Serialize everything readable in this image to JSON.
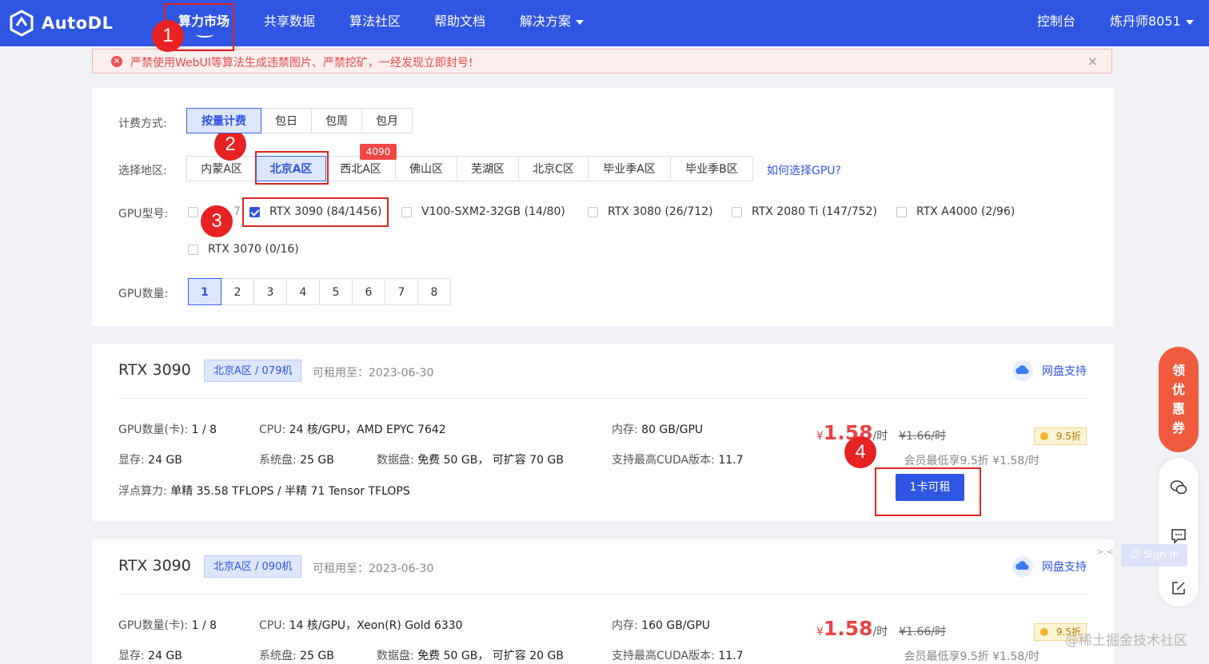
{
  "nav": {
    "brand": "AutoDL",
    "items": [
      "算力市场",
      "共享数据",
      "算法社区",
      "帮助文档",
      "解决方案"
    ],
    "console": "控制台",
    "user": "炼丹师8051"
  },
  "alert": {
    "text": "严禁使用WebUI等算法生成违禁图片、严禁挖矿，一经发现立即封号!",
    "close": "×"
  },
  "filters": {
    "billing_label": "计费方式:",
    "billing_options": [
      "按量计费",
      "包日",
      "包周",
      "包月"
    ],
    "region_label": "选择地区:",
    "region_options": [
      "内蒙A区",
      "北京A区",
      "西北A区",
      "佛山区",
      "芜湖区",
      "北京C区",
      "毕业季A区",
      "毕业季B区"
    ],
    "region_badge": "4090",
    "help_link": "如何选择GPU?",
    "gpu_label": "GPU型号:",
    "gpu_options": [
      {
        "label": "7",
        "checked": false
      },
      {
        "label": "RTX 3090 (84/1456)",
        "checked": true
      },
      {
        "label": "V100-SXM2-32GB (14/80)",
        "checked": false
      },
      {
        "label": "RTX 3080 (26/712)",
        "checked": false
      },
      {
        "label": "RTX 2080 Ti (147/752)",
        "checked": false
      },
      {
        "label": "RTX A4000 (2/96)",
        "checked": false
      },
      {
        "label": "RTX 3070 (0/16)",
        "checked": false
      }
    ],
    "count_label": "GPU数量:",
    "count_options": [
      "1",
      "2",
      "3",
      "4",
      "5",
      "6",
      "7",
      "8"
    ]
  },
  "cards": [
    {
      "title": "RTX 3090",
      "region": "北京A区 / 079机",
      "rent_until": "可租用至：2023-06-30",
      "cloud": "网盘支持",
      "gpu_count_label": "GPU数量(卡):",
      "gpu_count": "1 / 8",
      "cpu_label": "CPU:",
      "cpu": "24 核/GPU，AMD EPYC 7642",
      "mem_label": "内存:",
      "mem": "80 GB/GPU",
      "vram_label": "显存:",
      "vram": "24 GB",
      "sys_disk_label": "系统盘:",
      "sys_disk": "25 GB",
      "data_disk_label": "数据盘:",
      "data_disk": "免费 50 GB， 可扩容 70 GB",
      "cuda_label": "支持最高CUDA版本:",
      "cuda": "11.7",
      "flops_label": "浮点算力:",
      "flops": "单精 35.58 TFLOPS / 半精 71 Tensor TFLOPS",
      "currency": "¥",
      "price": "1.58",
      "unit": "/时",
      "orig_price": "¥1.66/时",
      "discount": "9.5折",
      "member": "会员最低享9.5折 ¥1.58/时",
      "rent_button": "1卡可租"
    },
    {
      "title": "RTX 3090",
      "region": "北京A区 / 090机",
      "rent_until": "可租用至：2023-06-30",
      "cloud": "网盘支持",
      "gpu_count_label": "GPU数量(卡):",
      "gpu_count": "1 / 8",
      "cpu_label": "CPU:",
      "cpu": "14 核/GPU，Xeon(R) Gold 6330",
      "mem_label": "内存:",
      "mem": "160 GB/GPU",
      "vram_label": "显存:",
      "vram": "24 GB",
      "sys_disk_label": "系统盘:",
      "sys_disk": "25 GB",
      "data_disk_label": "数据盘:",
      "data_disk": "免费 50 GB， 可扩容 20 GB",
      "cuda_label": "支持最高CUDA版本:",
      "cuda": "11.7",
      "currency": "¥",
      "price": "1.58",
      "unit": "/时",
      "orig_price": "¥1.66/时",
      "discount": "9.5折",
      "member": "会员最低享9.5折 ¥1.58/时"
    }
  ],
  "annotations": [
    "1",
    "2",
    "3",
    "4"
  ],
  "side": {
    "coupon": [
      "领",
      "优",
      "惠",
      "券"
    ],
    "sign_in": "Sign In",
    "sign_tip": ">.<"
  },
  "watermark": "@稀土掘金技术社区",
  "colors": {
    "primary": "#2f55e3",
    "danger": "#e02424",
    "price": "#e94444"
  }
}
